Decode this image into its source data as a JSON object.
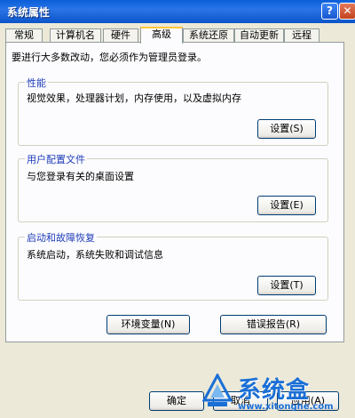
{
  "window": {
    "title": "系统属性"
  },
  "titlebar_buttons": {
    "help_label": "?",
    "close_label": "✕"
  },
  "tabs": [
    {
      "label": "常规"
    },
    {
      "label": "计算机名"
    },
    {
      "label": "硬件"
    },
    {
      "label": "高级",
      "active": true
    },
    {
      "label": "系统还原"
    },
    {
      "label": "自动更新"
    },
    {
      "label": "远程"
    }
  ],
  "intro_text": "要进行大多数改动，您必须作为管理员登录。",
  "groups": [
    {
      "title": "性能",
      "description": "视觉效果，处理器计划，内存使用，以及虚拟内存",
      "button": "设置(S)"
    },
    {
      "title": "用户配置文件",
      "description": "与您登录有关的桌面设置",
      "button": "设置(E)"
    },
    {
      "title": "启动和故障恢复",
      "description": "系统启动，系统失败和调试信息",
      "button": "设置(T)"
    }
  ],
  "lower_buttons": {
    "env": "环境变量(N)",
    "error": "错误报告(R)"
  },
  "dialog_buttons": {
    "ok": "确定",
    "cancel": "取消",
    "apply": "应用(A)"
  },
  "watermark": {
    "name": "系统盒",
    "url": "www.xitonghe.com"
  },
  "colors": {
    "titlebar": "#0a5fd8",
    "group_title": "#1e3cb8",
    "active_tab_accent": "#ffc83c",
    "watermark": "#1a6fd6"
  }
}
